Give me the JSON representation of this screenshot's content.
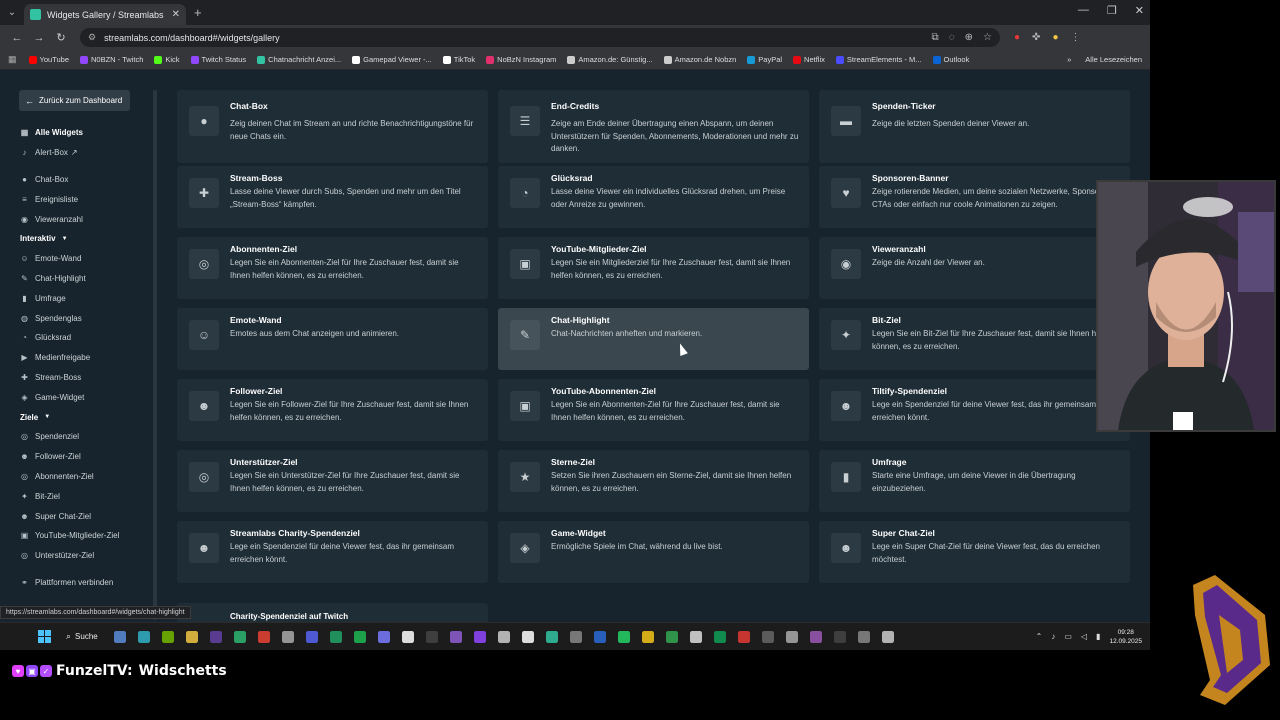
{
  "browser": {
    "tab_title": "Widgets Gallery / Streamlabs",
    "url": "streamlabs.com/dashboard#/widgets/gallery",
    "status_url": "https://streamlabs.com/dashboard#/widgets/chat-highlight",
    "bookmarks": [
      {
        "label": "YouTube",
        "color": "#ff0000"
      },
      {
        "label": "N0BZN - Twitch",
        "color": "#9146ff"
      },
      {
        "label": "Kick",
        "color": "#53fc18"
      },
      {
        "label": "Twitch Status",
        "color": "#9146ff"
      },
      {
        "label": "Chatnachricht Anzei...",
        "color": "#31c3a2"
      },
      {
        "label": "Gamepad Viewer -...",
        "color": "#ffffff"
      },
      {
        "label": "TikTok",
        "color": "#ffffff"
      },
      {
        "label": "NoBzN Instagram",
        "color": "#e1306c"
      },
      {
        "label": "Amazon.de: Günstig...",
        "color": "#cccccc"
      },
      {
        "label": "Amazon.de Nobzn",
        "color": "#cccccc"
      },
      {
        "label": "PayPal",
        "color": "#169bd7"
      },
      {
        "label": "Netflix",
        "color": "#e50914"
      },
      {
        "label": "StreamElements - M...",
        "color": "#4b4bff"
      },
      {
        "label": "Outlook",
        "color": "#0a64d6"
      }
    ],
    "all_bookmarks_label": "Alle Lesezeichen"
  },
  "sidebar": {
    "back_label": "Zurück zum Dashboard",
    "top_items": [
      {
        "label": "Alle Widgets",
        "icon": "grid-icon",
        "glyph": "▦"
      },
      {
        "label": "Alert-Box",
        "icon": "bell-icon",
        "glyph": "♪",
        "external": "↗"
      }
    ],
    "group1": [
      {
        "label": "Chat-Box",
        "icon": "chat-icon",
        "glyph": "●"
      },
      {
        "label": "Ereignisliste",
        "icon": "list-icon",
        "glyph": "≡"
      },
      {
        "label": "Vieweranzahl",
        "icon": "eye-icon",
        "glyph": "◉"
      }
    ],
    "section_interaktiv": "Interaktiv",
    "interaktiv": [
      {
        "label": "Emote-Wand",
        "icon": "smile-icon",
        "glyph": "☺"
      },
      {
        "label": "Chat-Highlight",
        "icon": "pen-icon",
        "glyph": "✎"
      },
      {
        "label": "Umfrage",
        "icon": "poll-icon",
        "glyph": "▮"
      },
      {
        "label": "Spendenglas",
        "icon": "jar-icon",
        "glyph": "◍"
      },
      {
        "label": "Glücksrad",
        "icon": "wheel-icon",
        "glyph": "◔"
      },
      {
        "label": "Medienfreigabe",
        "icon": "media-icon",
        "glyph": "▶"
      },
      {
        "label": "Stream-Boss",
        "icon": "hammer-icon",
        "glyph": "✚"
      },
      {
        "label": "Game-Widget",
        "icon": "gamepad-icon",
        "glyph": "◈"
      }
    ],
    "section_ziele": "Ziele",
    "ziele": [
      {
        "label": "Spendenziel",
        "icon": "target-icon",
        "glyph": "◎"
      },
      {
        "label": "Follower-Ziel",
        "icon": "user-plus-icon",
        "glyph": "☻"
      },
      {
        "label": "Abonnenten-Ziel",
        "icon": "subscriber-icon",
        "glyph": "◎"
      },
      {
        "label": "Bit-Ziel",
        "icon": "bits-icon",
        "glyph": "✦"
      },
      {
        "label": "Super Chat-Ziel",
        "icon": "superchat-icon",
        "glyph": "☻"
      },
      {
        "label": "YouTube-Mitglieder-Ziel",
        "icon": "youtube-member-icon",
        "glyph": "▣"
      },
      {
        "label": "Unterstützer-Ziel",
        "icon": "supporter-icon",
        "glyph": "◎"
      }
    ],
    "footer_item": {
      "label": "Plattformen verbinden",
      "icon": "link-icon",
      "glyph": "⚭"
    }
  },
  "widgets": [
    {
      "title": "Chat-Box",
      "desc": "Zeig deinen Chat im Stream an und richte Benachrichtigungstöne für neue Chats ein.",
      "icon": "chat-bubble-icon",
      "glyph": "●"
    },
    {
      "title": "End-Credits",
      "desc": "Zeige am Ende deiner Übertragung einen Abspann, um deinen Unterstützern für Spenden, Abonnements, Moderationen und mehr zu danken.",
      "icon": "credits-icon",
      "glyph": "☰"
    },
    {
      "title": "Spenden-Ticker",
      "desc": "Zeige die letzten Spenden deiner Viewer an.",
      "icon": "ticker-icon",
      "glyph": "▬"
    },
    {
      "title": "Stream-Boss",
      "desc": "Lasse deine Viewer durch Subs, Spenden und mehr um den Titel „Stream-Boss“ kämpfen.",
      "icon": "hammer-icon",
      "glyph": "✚"
    },
    {
      "title": "Glücksrad",
      "desc": "Lasse deine Viewer ein individuelles Glücksrad drehen, um Preise oder Anreize zu gewinnen.",
      "icon": "wheel-icon",
      "glyph": "◔"
    },
    {
      "title": "Sponsoren-Banner",
      "desc": "Zeige rotierende Medien, um deine sozialen Netzwerke, Sponsoren, CTAs oder einfach nur coole Animationen zu zeigen.",
      "icon": "heart-icon",
      "glyph": "♥"
    },
    {
      "title": "Abonnenten-Ziel",
      "desc": "Legen Sie ein Abonnenten-Ziel für Ihre Zuschauer fest, damit sie Ihnen helfen können, es zu erreichen.",
      "icon": "subscriber-goal-icon",
      "glyph": "◎"
    },
    {
      "title": "YouTube-Mitglieder-Ziel",
      "desc": "Legen Sie ein Mitgliederziel für Ihre Zuschauer fest, damit sie Ihnen helfen können, es zu erreichen.",
      "icon": "youtube-member-icon",
      "glyph": "▣"
    },
    {
      "title": "Vieweranzahl",
      "desc": "Zeige die Anzahl der Viewer an.",
      "icon": "eye-icon",
      "glyph": "◉"
    },
    {
      "title": "Emote-Wand",
      "desc": "Emotes aus dem Chat anzeigen und animieren.",
      "icon": "smile-icon",
      "glyph": "☺"
    },
    {
      "title": "Chat-Highlight",
      "desc": "Chat-Nachrichten anheften und markieren.",
      "icon": "pen-icon",
      "glyph": "✎",
      "hover": true
    },
    {
      "title": "Bit-Ziel",
      "desc": "Legen Sie ein Bit-Ziel für Ihre Zuschauer fest, damit sie Ihnen helfen können, es zu erreichen.",
      "icon": "bits-icon",
      "glyph": "✦"
    },
    {
      "title": "Follower-Ziel",
      "desc": "Legen Sie ein Follower-Ziel für Ihre Zuschauer fest, damit sie Ihnen helfen können, es zu erreichen.",
      "icon": "user-plus-icon",
      "glyph": "☻"
    },
    {
      "title": "YouTube-Abonnenten-Ziel",
      "desc": "Legen Sie ein Abonnenten-Ziel für Ihre Zuschauer fest, damit sie Ihnen helfen können, es zu erreichen.",
      "icon": "youtube-sub-icon",
      "glyph": "▣"
    },
    {
      "title": "Tiltify-Spendenziel",
      "desc": "Lege ein Spendenziel für deine Viewer fest, das ihr gemeinsam erreichen könnt.",
      "icon": "tiltify-icon",
      "glyph": "☻"
    },
    {
      "title": "Unterstützer-Ziel",
      "desc": "Legen Sie ein Unterstützer-Ziel für Ihre Zuschauer fest, damit sie Ihnen helfen können, es zu erreichen.",
      "icon": "supporter-icon",
      "glyph": "◎"
    },
    {
      "title": "Sterne-Ziel",
      "desc": "Setzen Sie ihren Zuschauern ein Sterne-Ziel, damit sie Ihnen helfen können, es zu erreichen.",
      "icon": "star-icon",
      "glyph": "★"
    },
    {
      "title": "Umfrage",
      "desc": "Starte eine Umfrage, um deine Viewer in die Übertragung einzubeziehen.",
      "icon": "poll-icon",
      "glyph": "▮"
    },
    {
      "title": "Streamlabs Charity-Spendenziel",
      "desc": "Lege ein Spendenziel für deine Viewer fest, das ihr gemeinsam erreichen könnt.",
      "icon": "charity-icon",
      "glyph": "☻"
    },
    {
      "title": "Game-Widget",
      "desc": "Ermögliche Spiele im Chat, während du live bist.",
      "icon": "gamepad-icon",
      "glyph": "◈"
    },
    {
      "title": "Super Chat-Ziel",
      "desc": "Lege ein Super Chat-Ziel für deine Viewer fest, das du erreichen möchtest.",
      "icon": "superchat-icon",
      "glyph": "☻"
    }
  ],
  "partial_card_title": "Charity-Spendenziel auf Twitch",
  "taskbar": {
    "search_label": "Suche",
    "time": "09:28",
    "date": "12.09.2025",
    "app_colors": [
      "#5b8dd9",
      "#30b0c7",
      "#76b900",
      "#f2c744",
      "#6441a5",
      "#2bb673",
      "#ea4335",
      "#aaaaaa",
      "#5865f2",
      "#21a366",
      "#1db954",
      "#7a7aff",
      "#ffffff",
      "#444444",
      "#8f5fd1",
      "#9146ff",
      "#cccccc",
      "#ffffff",
      "#31c3a2",
      "#888888",
      "#2a6ad8",
      "#25d366",
      "#f5c518",
      "#33a852",
      "#dddddd",
      "#0f9d58",
      "#e53935",
      "#666666",
      "#aaaaaa",
      "#9b59b6",
      "#444444",
      "#888888",
      "#cccccc"
    ]
  },
  "overlay": {
    "channel": "FunzelTV:",
    "topic": "Widschetts",
    "colors": {
      "heart": "#e040fb",
      "twitch": "#9146ff",
      "check": "#b44cff"
    }
  },
  "colors": {
    "accent": "#31c3a2",
    "card": "#1f2d36",
    "card_hover": "#3a474f",
    "page": "#17242d"
  }
}
